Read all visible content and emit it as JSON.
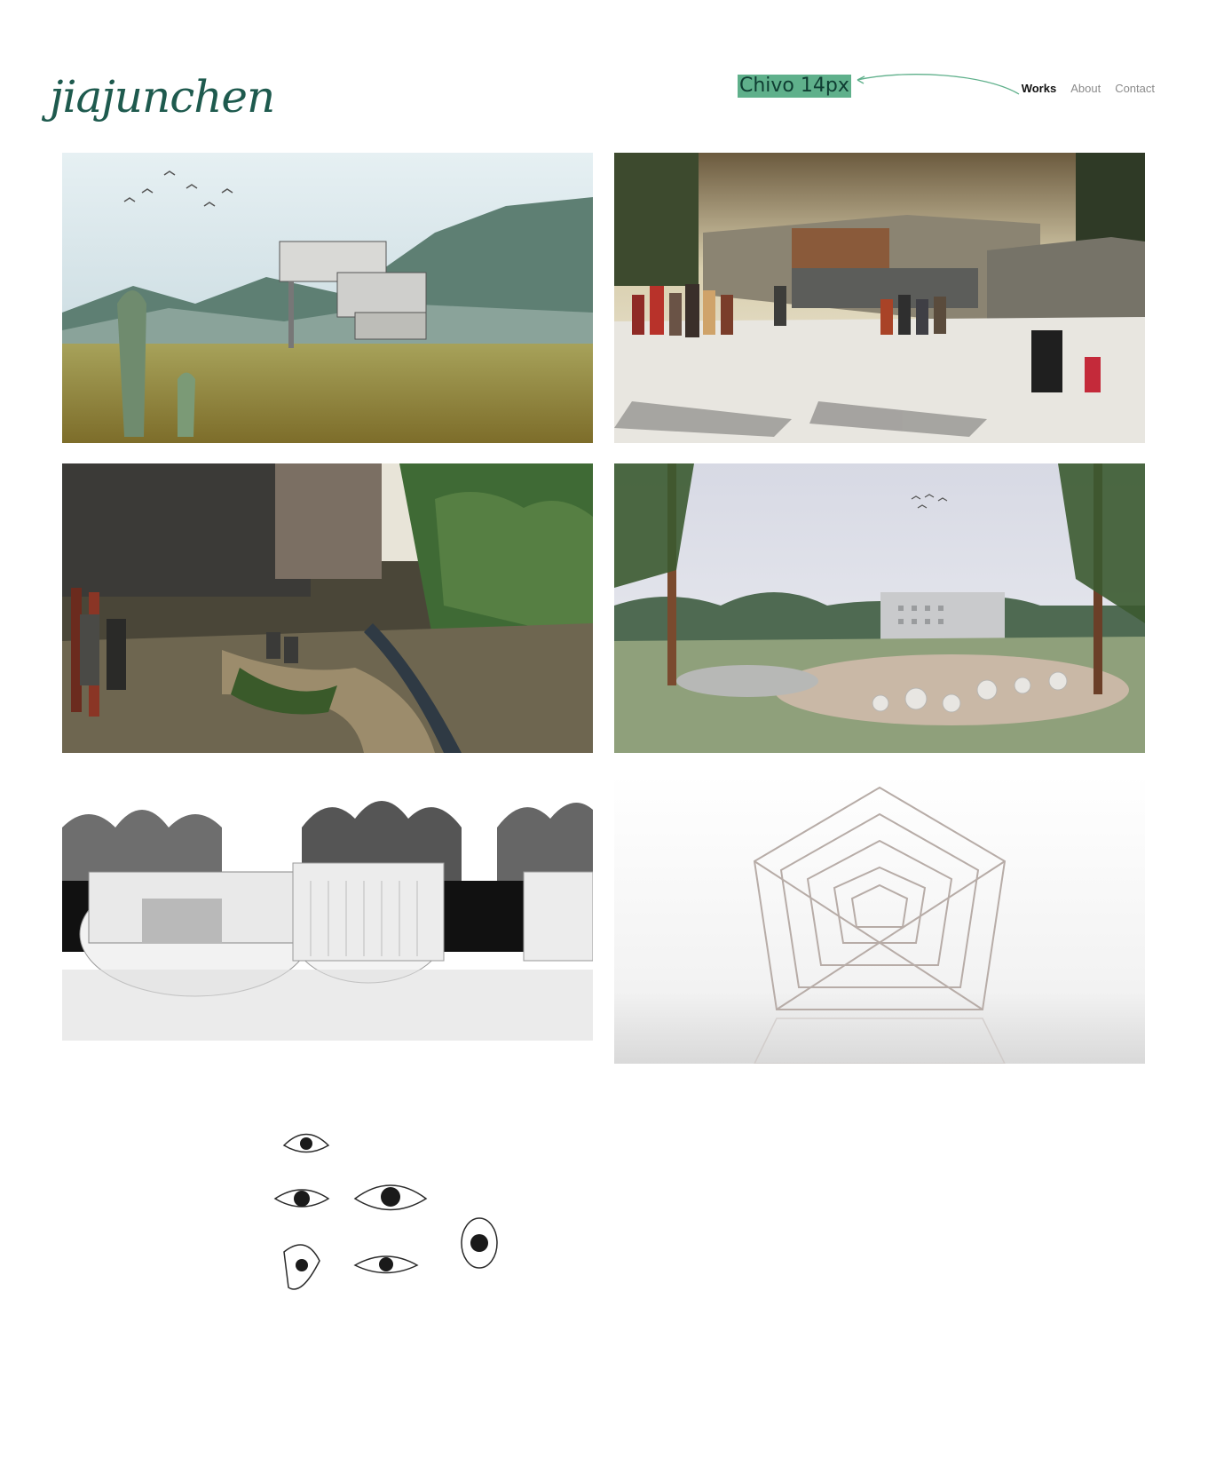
{
  "header": {
    "logo_text": "jiajunchen",
    "annotation_label": "Chivo 14px",
    "nav": [
      {
        "label": "Works",
        "active": true
      },
      {
        "label": "About",
        "active": false
      },
      {
        "label": "Contact",
        "active": false
      }
    ]
  },
  "colors": {
    "brand": "#1e5a4e",
    "annotation_bg": "#5fb08b",
    "nav_active": "#111111",
    "nav_inactive": "#8b8b8b"
  },
  "projects": [
    {
      "image": "desert-house-render"
    },
    {
      "image": "plaza-crowd-render"
    },
    {
      "image": "garden-courtyard-render"
    },
    {
      "image": "park-spheres-render"
    },
    {
      "image": "cylindrical-buildings-render"
    },
    {
      "image": "pentagon-sculpture-render"
    },
    {
      "image": "eye-sketches-drawing"
    }
  ]
}
